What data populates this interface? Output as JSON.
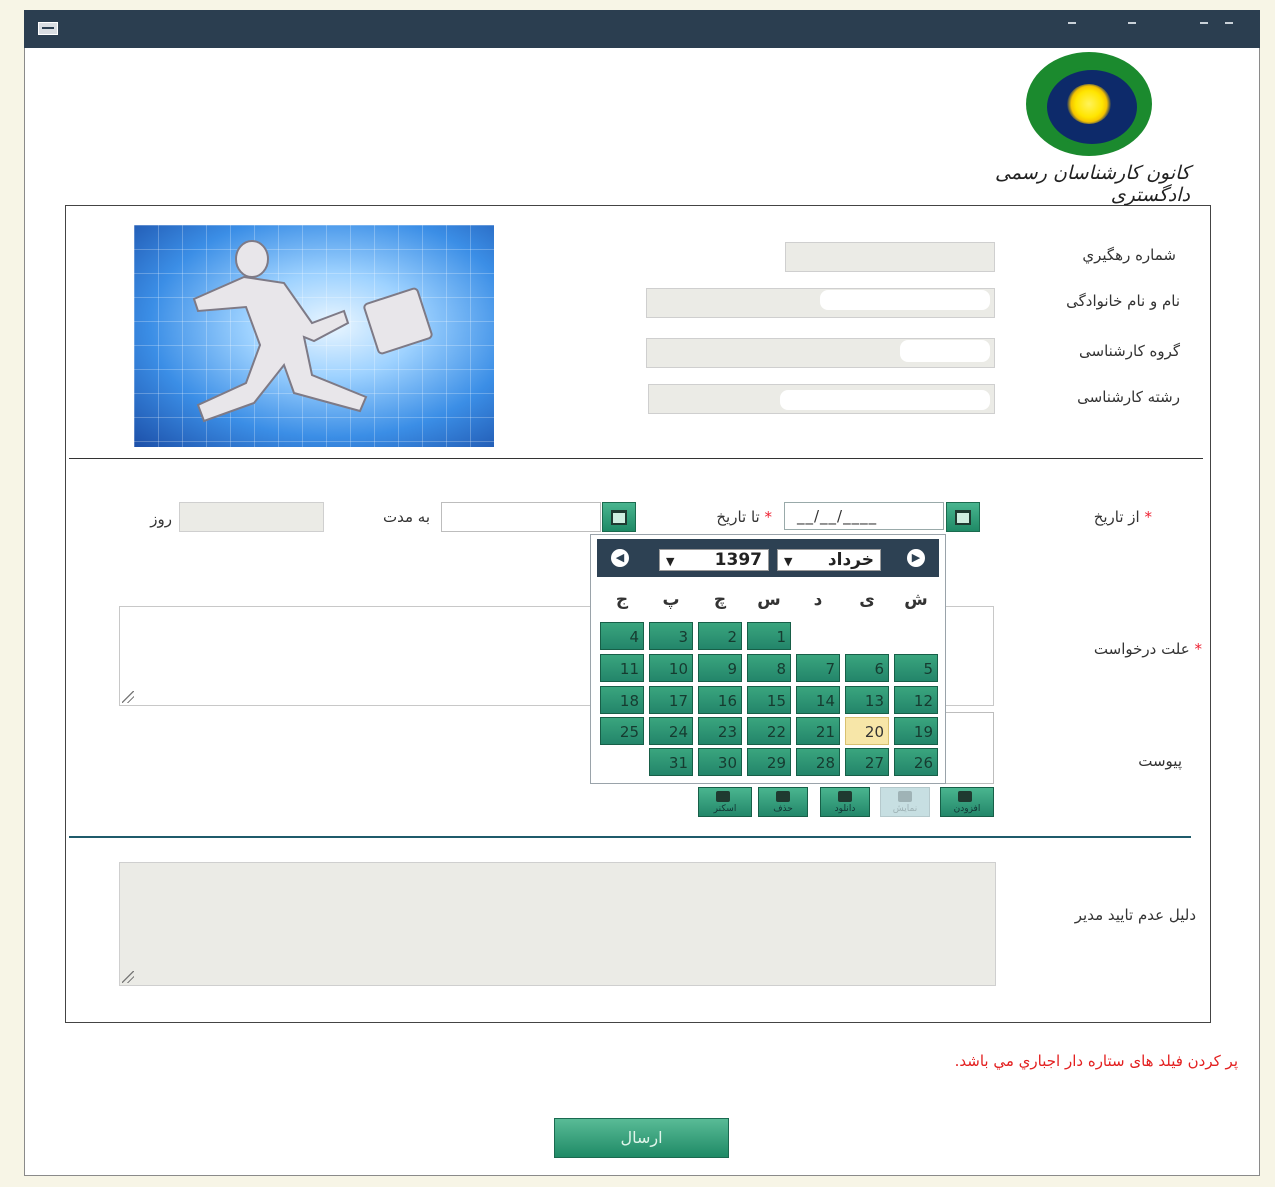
{
  "logo": {
    "org_name": "کانون کارشناسان رسمی دادگستری"
  },
  "form": {
    "tracking_label": "شماره رهگيري",
    "name_label": "نام و نام خانوادگی",
    "group_label": "گروه کارشناسی",
    "field_label": "رشته کارشناسی",
    "from_date_label": "از تاريخ",
    "to_date_label": "تا تاريخ",
    "duration_label": "به مدت",
    "days_label": "روز",
    "date_mask": "__/__/____",
    "reason_label": "علت درخواست",
    "attachment_label": "پیوست",
    "reject_reason_label": "دليل عدم تاييد مدير",
    "required_mark": "*",
    "required_note": "پر کردن فیلد های ستاره دار اجباري مي باشد.",
    "submit_label": "ارسال"
  },
  "calendar": {
    "month": "خرداد",
    "year": "1397",
    "weekdays": [
      "ش",
      "ی",
      "د",
      "س",
      "چ",
      "پ",
      "ج"
    ],
    "today": "20",
    "days": [
      "1",
      "2",
      "3",
      "4",
      "5",
      "6",
      "7",
      "8",
      "9",
      "10",
      "11",
      "12",
      "13",
      "14",
      "15",
      "16",
      "17",
      "18",
      "19",
      "20",
      "21",
      "22",
      "23",
      "24",
      "25",
      "26",
      "27",
      "28",
      "29",
      "30",
      "31"
    ]
  },
  "attachment_toolbar": {
    "add": "افزودن",
    "view": "نمايش",
    "download": "دانلود",
    "delete": "حذف",
    "scan": "اسکنر"
  },
  "colors": {
    "accent": "#23856a",
    "titlebar": "#2b3e50",
    "required": "#e32020"
  }
}
